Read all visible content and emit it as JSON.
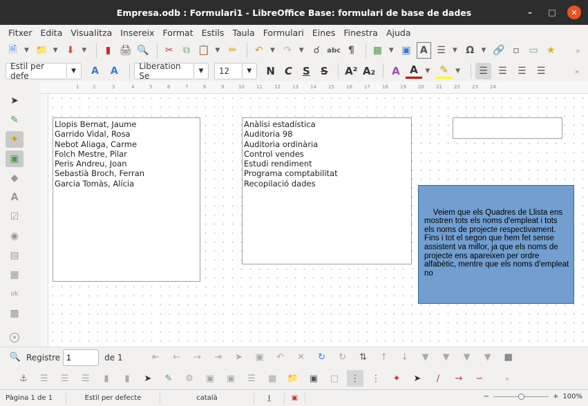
{
  "window": {
    "title": "Empresa.odb : Formulari1 - LibreOffice Base: formulari de base de dades"
  },
  "menu": [
    "Fitxer",
    "Edita",
    "Visualitza",
    "Insereix",
    "Format",
    "Estils",
    "Taula",
    "Formulari",
    "Eines",
    "Finestra",
    "Ajuda"
  ],
  "formatting": {
    "style": "Estil per defe",
    "font": "Liberation Se",
    "size": "12"
  },
  "form": {
    "employees": [
      "Llopis Bernat, Jaume",
      "Garrido Vidal, Rosa",
      "Nebot Aliaga, Carme",
      "Folch Mestre, Pilar",
      "Peris Andreu, Joan",
      "Sebastià Broch, Ferran",
      "Garcia Tomàs, Alícia"
    ],
    "projects": [
      "Anàlisi estadística",
      "Auditoria 98",
      "Auditoria ordinària",
      "Control vendes",
      "Estudi rendiment",
      "Programa comptabilitat",
      "Recopilació dades"
    ],
    "note": "Veiem que els Quadres de Llista ens mostren tots els noms d'empleat i tots els noms de projecte respectivament.\nFins i tot el segon que hem fet sense assistent va millor, ja que els noms de projecte ens apareixen per ordre alfabètic, mentre que els noms d'empleat no"
  },
  "navigation": {
    "record_label": "Registre",
    "record_value": "1",
    "of_label": "de 1"
  },
  "status": {
    "page": "Pàgina 1 de 1",
    "style": "Estil per defecte",
    "language": "català",
    "zoom": "100%"
  },
  "ruler": [
    "1",
    "2",
    "3",
    "4",
    "5",
    "6",
    "7",
    "8",
    "9",
    "10",
    "11",
    "12",
    "13",
    "14",
    "15",
    "16",
    "17",
    "18",
    "19",
    "20",
    "21",
    "22",
    "23",
    "24"
  ],
  "colors": {
    "title_bg": "#2d2d2d",
    "close": "#e95420",
    "note_bg": "#729fcf"
  }
}
